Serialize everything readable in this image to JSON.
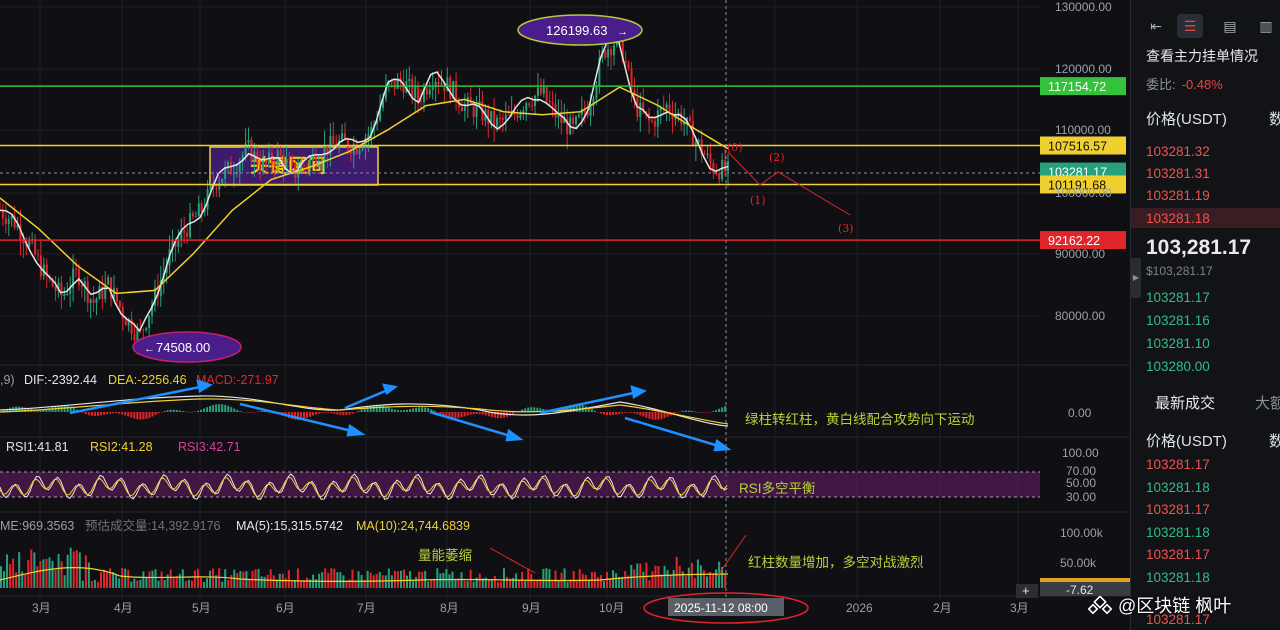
{
  "chart_data": {
    "type": "candlestick",
    "symbol_quote": "USDT",
    "x_ticks": [
      "3月",
      "4月",
      "5月",
      "6月",
      "7月",
      "8月",
      "9月",
      "10月",
      "2026",
      "2月",
      "3月"
    ],
    "y_ticks": [
      "130000.00",
      "120000.00",
      "110000.00",
      "100000.00",
      "90000.00",
      "80000.00"
    ],
    "ylim": [
      74000,
      130000
    ],
    "horizontal_levels": [
      {
        "label": "117154.72",
        "value": 117154.72,
        "color": "#33c23a"
      },
      {
        "label": "107516.57",
        "value": 107516.57,
        "color": "#f0d030"
      },
      {
        "label": "103281.17",
        "value": 103281.17,
        "color": "#26a17b"
      },
      {
        "label": "101191.68",
        "value": 101191.68,
        "color": "#f0d030"
      },
      {
        "label": "92162.22",
        "value": 92162.22,
        "color": "#e0252b"
      }
    ],
    "annotations": {
      "key_zone": "关键区间",
      "high": "126199.63",
      "low": "74508.00",
      "wave_0": "(0)",
      "wave_1": "(1)",
      "wave_2": "(2)",
      "wave_3": "(3)"
    },
    "macd": {
      "prefix": ",9)",
      "dif": "DIF:-2392.44",
      "dea": "DEA:-2256.46",
      "macd": "MACD:-271.97",
      "zero_tick": "0.00",
      "note": "绿柱转红柱，黄白线配合攻势向下运动"
    },
    "rsi": {
      "rsi1": "RSI1:41.81",
      "rsi2": "RSI2:41.28",
      "rsi3": "RSI3:42.71",
      "ticks": [
        "100.00",
        "70.00",
        "50.00",
        "30.00"
      ],
      "note": "RSI多空平衡"
    },
    "volume": {
      "prefix": "ME:969.3563",
      "est": "预估成交量:14,392.9176",
      "ma5": "MA(5):15,315.5742",
      "ma10": "MA(10):24,744.6839",
      "ticks": [
        "100.00k",
        "50.00k"
      ],
      "note_left": "量能萎缩",
      "note_right": "红柱数量增加，多空对战激烈",
      "partial_value": "-7.62"
    },
    "crosshair_date": "2025-11-12 08:00",
    "price_series": [
      [
        0,
        97000
      ],
      [
        0.02,
        95000
      ],
      [
        0.04,
        91000
      ],
      [
        0.06,
        86000
      ],
      [
        0.08,
        83000
      ],
      [
        0.1,
        87000
      ],
      [
        0.12,
        82000
      ],
      [
        0.14,
        85000
      ],
      [
        0.16,
        80000
      ],
      [
        0.18,
        76500
      ],
      [
        0.2,
        83000
      ],
      [
        0.22,
        90000
      ],
      [
        0.24,
        94000
      ],
      [
        0.26,
        97000
      ],
      [
        0.28,
        102000
      ],
      [
        0.3,
        104000
      ],
      [
        0.32,
        107000
      ],
      [
        0.34,
        104000
      ],
      [
        0.36,
        106000
      ],
      [
        0.38,
        103000
      ],
      [
        0.4,
        105000
      ],
      [
        0.42,
        107000
      ],
      [
        0.44,
        108000
      ],
      [
        0.46,
        107500
      ],
      [
        0.48,
        110000
      ],
      [
        0.5,
        117000
      ],
      [
        0.52,
        118000
      ],
      [
        0.54,
        115000
      ],
      [
        0.56,
        119000
      ],
      [
        0.58,
        117000
      ],
      [
        0.6,
        114000
      ],
      [
        0.62,
        113000
      ],
      [
        0.64,
        111000
      ],
      [
        0.66,
        112000
      ],
      [
        0.68,
        115000
      ],
      [
        0.7,
        116000
      ],
      [
        0.72,
        112000
      ],
      [
        0.74,
        110000
      ],
      [
        0.76,
        114000
      ],
      [
        0.78,
        123000
      ],
      [
        0.8,
        125000
      ],
      [
        0.82,
        114000
      ],
      [
        0.84,
        111000
      ],
      [
        0.86,
        114000
      ],
      [
        0.88,
        112000
      ],
      [
        0.9,
        108000
      ],
      [
        0.92,
        104000
      ],
      [
        0.94,
        103281
      ]
    ],
    "ma_series": [
      [
        0,
        99000
      ],
      [
        0.05,
        94000
      ],
      [
        0.1,
        88000
      ],
      [
        0.15,
        83500
      ],
      [
        0.2,
        84000
      ],
      [
        0.25,
        90000
      ],
      [
        0.3,
        97000
      ],
      [
        0.35,
        102000
      ],
      [
        0.4,
        104000
      ],
      [
        0.45,
        106500
      ],
      [
        0.5,
        110000
      ],
      [
        0.55,
        114000
      ],
      [
        0.6,
        115000
      ],
      [
        0.65,
        113000
      ],
      [
        0.7,
        112500
      ],
      [
        0.75,
        113000
      ],
      [
        0.8,
        117000
      ],
      [
        0.85,
        114000
      ],
      [
        0.9,
        110000
      ],
      [
        0.94,
        107000
      ]
    ]
  },
  "order_book": {
    "title": "查看主力挂单情况",
    "ratio_label": "委比:",
    "ratio_value": "-0.48%",
    "col_price": "价格(USDT)",
    "col_more": "数",
    "asks": [
      "103281.32",
      "103281.31",
      "103281.19",
      "103281.18"
    ],
    "last_price": "103,281.17",
    "last_price_usd": "$103,281.17",
    "bids": [
      "103281.17",
      "103281.16",
      "103281.10",
      "103280.00"
    ],
    "tab_trades": "最新成交",
    "tab_large": "大额",
    "trades_col_price": "价格(USDT)",
    "trades_col_more": "数",
    "trades": [
      {
        "price": "103281.17",
        "side": "sell"
      },
      {
        "price": "103281.18",
        "side": "buy"
      },
      {
        "price": "103281.17",
        "side": "sell"
      },
      {
        "price": "103281.18",
        "side": "buy"
      },
      {
        "price": "103281.17",
        "side": "sell"
      },
      {
        "price": "103281.18",
        "side": "buy"
      },
      {
        "price": "103281.17",
        "side": "sell"
      }
    ]
  },
  "watermark": "@区块链 枫叶",
  "colors": {
    "up": "#26a17b",
    "down": "#e0252b",
    "ma_yellow": "#f0d030",
    "zone_purple": "#4b1d8a",
    "arrow_blue": "#1e90ff"
  }
}
